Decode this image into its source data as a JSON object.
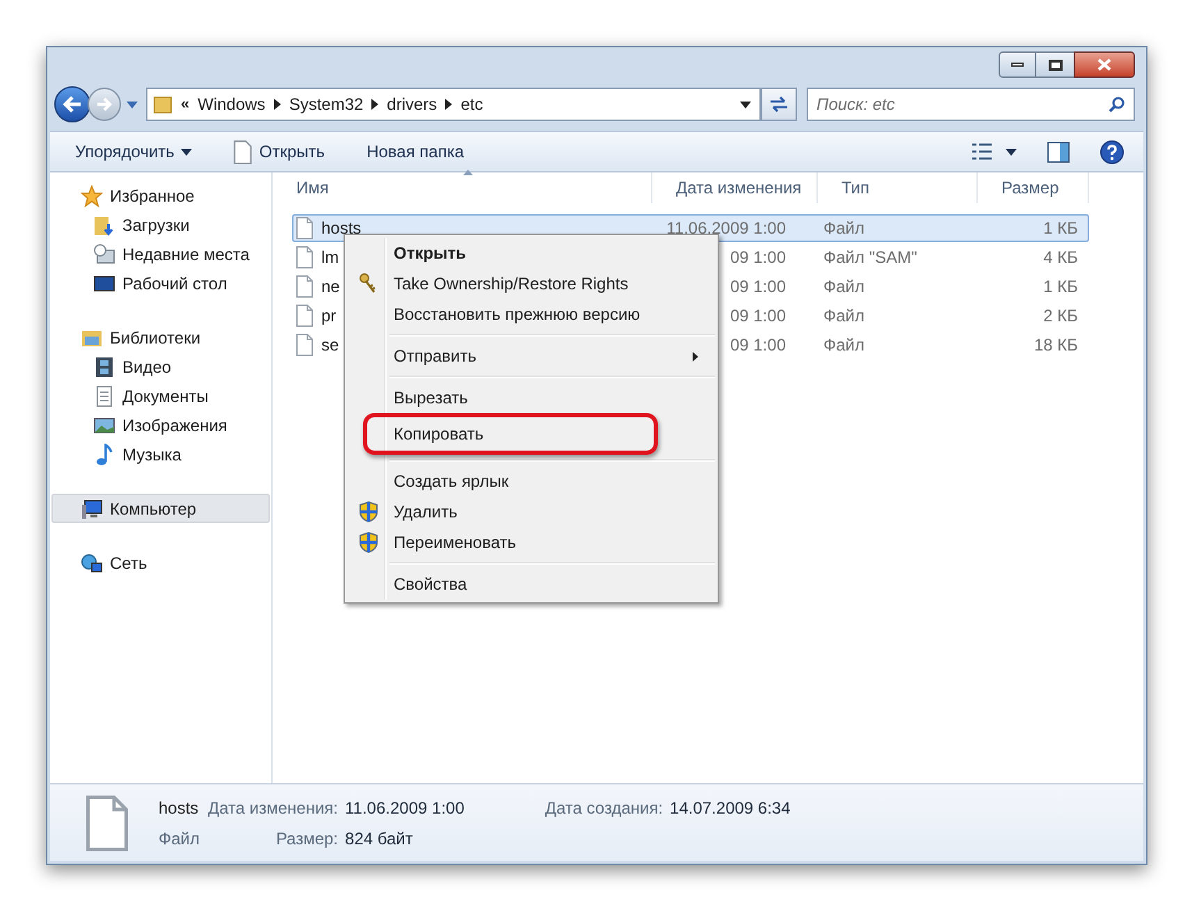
{
  "address": {
    "overflow": "«",
    "crumbs": [
      "Windows",
      "System32",
      "drivers",
      "etc"
    ]
  },
  "search": {
    "placeholder": "Поиск: etc"
  },
  "toolbar": [
    {
      "label": "Упорядочить",
      "kind": "menu"
    },
    {
      "label": "Открыть",
      "kind": "file"
    },
    {
      "label": "Новая папка",
      "kind": "plain"
    }
  ],
  "sidebar": {
    "groups": [
      {
        "label": "Избранное",
        "selected": false,
        "children": [
          {
            "label": "Загрузки"
          },
          {
            "label": "Недавние места"
          },
          {
            "label": "Рабочий стол"
          }
        ]
      },
      {
        "label": "Библиотеки",
        "selected": false,
        "children": [
          {
            "label": "Видео"
          },
          {
            "label": "Документы"
          },
          {
            "label": "Изображения"
          },
          {
            "label": "Музыка"
          }
        ]
      },
      {
        "label": "Компьютер",
        "selected": true
      },
      {
        "label": "Сеть",
        "selected": false
      }
    ]
  },
  "table": {
    "columns": [
      "Имя",
      "Дата изменения",
      "Тип",
      "Размер"
    ],
    "rows": [
      {
        "name": "hosts",
        "date": "11.06.2009 1:00",
        "type": "Файл",
        "size": "1 КБ",
        "selected": true
      },
      {
        "name": "lm",
        "date": "09 1:00",
        "type": "Файл \"SAM\"",
        "size": "4 КБ",
        "selected": false
      },
      {
        "name": "ne",
        "date": "09 1:00",
        "type": "Файл",
        "size": "1 КБ",
        "selected": false
      },
      {
        "name": "pr",
        "date": "09 1:00",
        "type": "Файл",
        "size": "2 КБ",
        "selected": false
      },
      {
        "name": "se",
        "date": "09 1:00",
        "type": "Файл",
        "size": "18 КБ",
        "selected": false
      }
    ]
  },
  "context_menu": [
    {
      "kind": "item",
      "label": "Открыть",
      "bold": true
    },
    {
      "kind": "item",
      "label": "Take Ownership/Restore Rights",
      "bold": false
    },
    {
      "kind": "item",
      "label": "Восстановить прежнюю версию",
      "bold": false
    },
    {
      "kind": "separator"
    },
    {
      "kind": "item",
      "label": "Отправить",
      "bold": false,
      "submenu": true
    },
    {
      "kind": "separator"
    },
    {
      "kind": "item",
      "label": "Вырезать",
      "bold": false
    },
    {
      "kind": "item",
      "label": "Копировать",
      "bold": false,
      "highlighted": true
    },
    {
      "kind": "separator"
    },
    {
      "kind": "item",
      "label": "Создать ярлык",
      "bold": false
    },
    {
      "kind": "item",
      "label": "Удалить",
      "bold": false
    },
    {
      "kind": "item",
      "label": "Переименовать",
      "bold": false
    },
    {
      "kind": "separator"
    },
    {
      "kind": "item",
      "label": "Свойства",
      "bold": false
    }
  ],
  "details": {
    "name": "hosts",
    "type": "Файл",
    "fields": [
      {
        "label": "Дата изменения:",
        "value": "11.06.2009 1:00"
      },
      {
        "label": "Размер:",
        "value": "824 байт"
      },
      {
        "label": "Дата создания:",
        "value": "14.07.2009 6:34"
      }
    ]
  }
}
